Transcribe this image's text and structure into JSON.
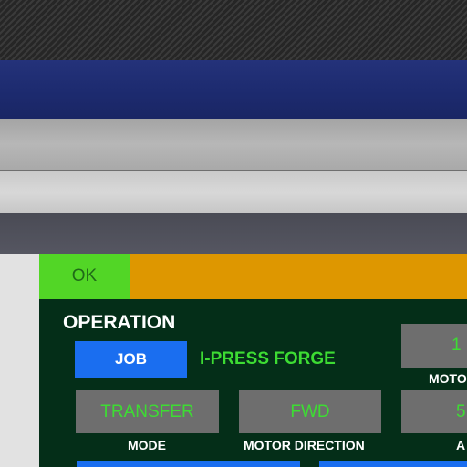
{
  "status": {
    "text": "OK"
  },
  "operation": {
    "title": "OPERATION",
    "mode_button": "JOB",
    "machine_name": "I-PRESS FORGE",
    "tiles": {
      "motor_partial": {
        "value": "1",
        "label": "MOTO"
      },
      "mode": {
        "value": "TRANSFER",
        "label": "MODE"
      },
      "motor_direction": {
        "value": "FWD",
        "label": "MOTOR DIRECTION"
      },
      "right_partial": {
        "value": "5",
        "label": "A"
      }
    }
  },
  "colors": {
    "status_ok": "#52d626",
    "status_bar": "#de9700",
    "panel_bg": "#042e18",
    "accent_green": "#3ddc33",
    "button_blue": "#1a6ef0",
    "tile_gray": "#6e6e6e"
  }
}
